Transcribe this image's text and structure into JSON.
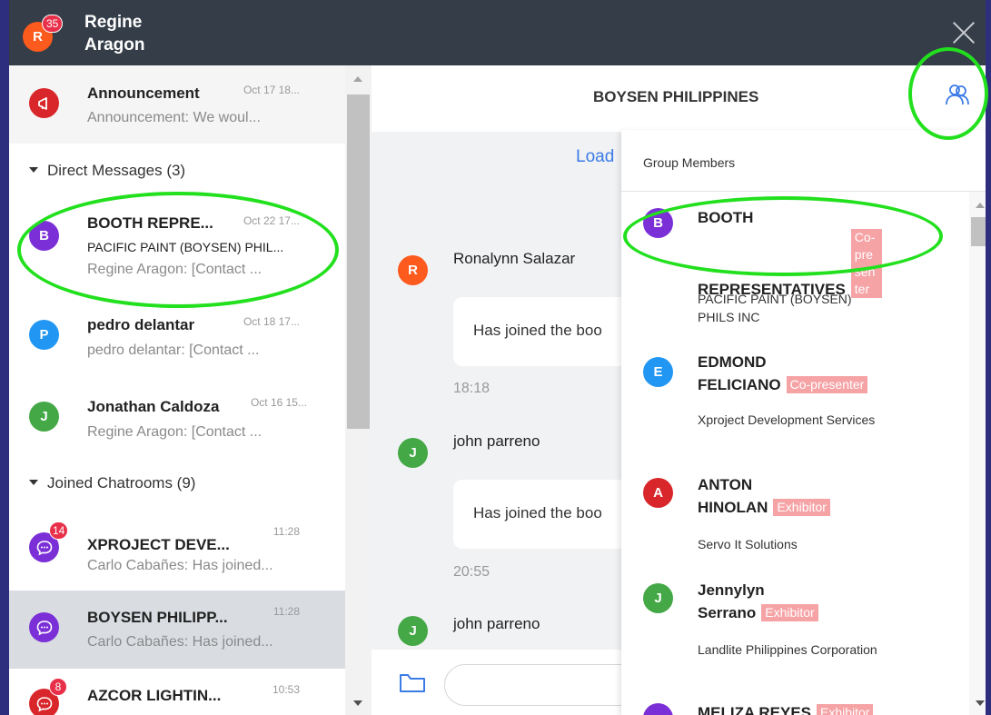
{
  "user": {
    "initial": "R",
    "first_name": "Regine",
    "last_name": "Aragon",
    "badge": "35"
  },
  "sidebar": {
    "announcement": {
      "title": "Announcement",
      "time": "Oct 17 18...",
      "preview": "Announcement: We woul..."
    },
    "direct_messages_header": "Direct Messages (3)",
    "direct_messages": [
      {
        "initial": "B",
        "title": "BOOTH REPRE...",
        "time": "Oct 22 17...",
        "line2": "PACIFIC PAINT (BOYSEN) PHIL...",
        "preview": "Regine Aragon: [Contact ..."
      },
      {
        "initial": "P",
        "title": "pedro delantar",
        "time": "Oct 18 17...",
        "preview": "pedro delantar: [Contact ..."
      },
      {
        "initial": "J",
        "title": "Jonathan Caldoza",
        "time": "Oct 16 15...",
        "preview": "Regine Aragon: [Contact ..."
      }
    ],
    "chatrooms_header": "Joined Chatrooms (9)",
    "chatrooms": [
      {
        "title": "XPROJECT DEVE...",
        "time": "11:28",
        "preview": "Carlo Cabañes: Has joined...",
        "badge": "14"
      },
      {
        "title": "BOYSEN PHILIPP...",
        "time": "11:28",
        "preview": "Carlo Cabañes: Has joined..."
      },
      {
        "title": "AZCOR LIGHTIN...",
        "time": "10:53",
        "badge": "8"
      }
    ]
  },
  "chat": {
    "title": "BOYSEN PHILIPPINES",
    "load_more": "Load",
    "messages": [
      {
        "initial": "R",
        "name": "Ronalynn Salazar",
        "text": "Has joined the boo",
        "time": "18:18"
      },
      {
        "initial": "J",
        "name": "john parreno",
        "text": "Has joined the boo",
        "time": "20:55"
      },
      {
        "initial": "J",
        "name": "john parreno"
      }
    ],
    "composer_placeholder": ""
  },
  "members": {
    "header": "Group Members",
    "list": [
      {
        "initial": "B",
        "name_line1": "BOOTH",
        "name_line2": "REPRESENTATIVES",
        "tag": "Co-presenter",
        "org": "PACIFIC PAINT (BOYSEN) PHILS INC"
      },
      {
        "initial": "E",
        "name_line1": "EDMOND",
        "name_line2": "FELICIANO",
        "tag": "Co-presenter",
        "org": "Xproject Development Services"
      },
      {
        "initial": "A",
        "name_line1": "ANTON",
        "name_line2": "HINOLAN",
        "tag": "Exhibitor",
        "org": "Servo It Solutions"
      },
      {
        "initial": "J",
        "name_line1": "Jennylyn",
        "name_line2": "Serrano",
        "tag": "Exhibitor",
        "org": "Landlite Philippines Corporation"
      },
      {
        "name_line1": "MELIZA REYES",
        "tag": "Exhibitor"
      }
    ]
  },
  "colors": {
    "header_bg": "#343d48",
    "accent_blue": "#3b7be6",
    "badge_red": "#e8304a",
    "tag_pink": "#f6a3a6",
    "highlight_green": "#22e01e",
    "avatar_orange": "#fd5a1e",
    "avatar_purple": "#7b2fd6",
    "avatar_blue": "#2196f3",
    "avatar_green": "#43a845",
    "avatar_red": "#d8262b"
  },
  "icons": {
    "announcement": "megaphone-icon",
    "chatroom": "chat-bubble-icon",
    "members": "group-members-icon",
    "attach": "folder-icon",
    "close": "close-icon"
  }
}
